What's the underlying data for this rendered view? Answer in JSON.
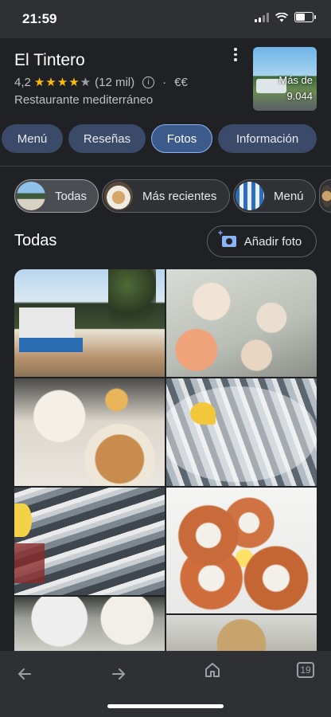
{
  "status": {
    "time": "21:59"
  },
  "place": {
    "name": "El Tintero",
    "rating": "4,2",
    "stars": "★★★★",
    "star_empty": "★",
    "reviews": "(12 mil)",
    "price": "€€",
    "category": "Restaurante mediterráneo",
    "thumb_label_1": "Más de",
    "thumb_label_2": "9.044"
  },
  "tabs": [
    {
      "label": "Menú"
    },
    {
      "label": "Reseñas"
    },
    {
      "label": "Fotos",
      "active": true
    },
    {
      "label": "Información"
    }
  ],
  "chips": [
    {
      "label": "Todas",
      "active": true
    },
    {
      "label": "Más recientes"
    },
    {
      "label": "Menú"
    }
  ],
  "section": {
    "title": "Todas",
    "add_photo": "Añadir foto"
  },
  "bottom": {
    "tabs_count": "19"
  },
  "colors": {
    "accent": "#8ab4f8",
    "star": "#fbbc04",
    "background": "#202124"
  }
}
